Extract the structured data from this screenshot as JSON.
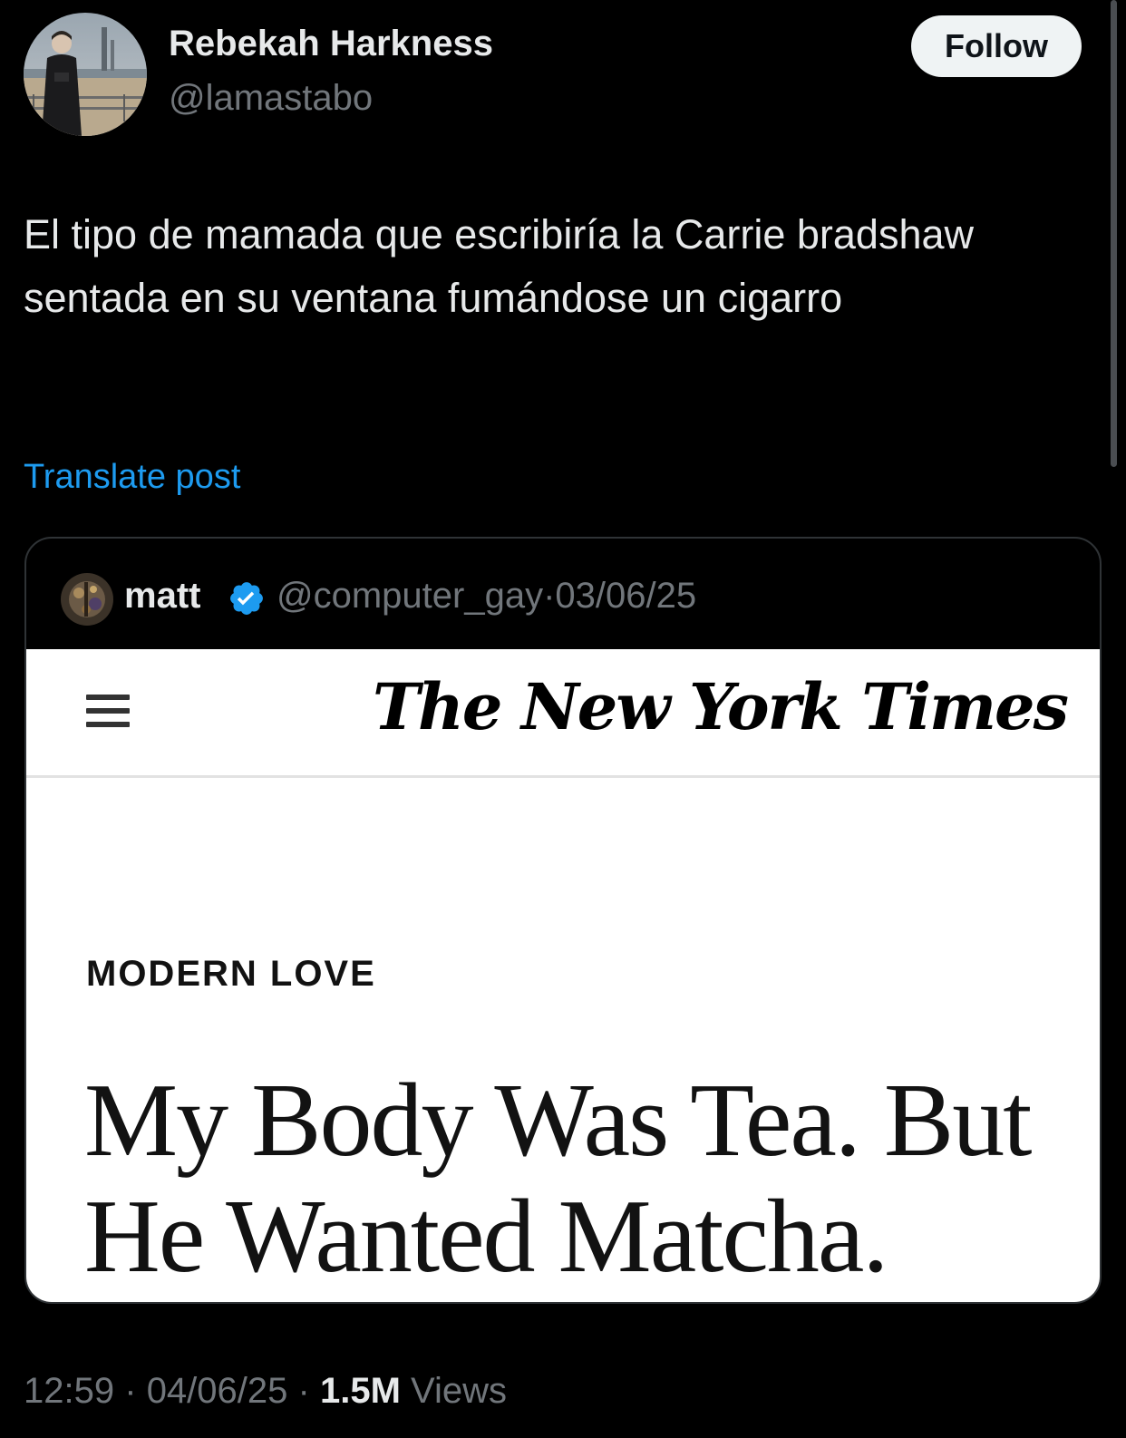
{
  "author": {
    "display_name": "Rebekah Harkness",
    "handle": "@lamastabo",
    "follow_label": "Follow"
  },
  "post": {
    "text": "El tipo de mamada que escribiría la Carrie bradshaw sentada en su ventana fumándose un cigarro",
    "translate_label": "Translate post"
  },
  "quoted_post": {
    "display_name": "matt",
    "handle": "@computer_gay",
    "separator": "·",
    "date": "03/06/25",
    "image": {
      "publication": "The New York Times",
      "kicker": "MODERN LOVE",
      "headline_line1": "My Body Was Tea. But",
      "headline_line2": "He Wanted Matcha."
    }
  },
  "meta": {
    "time": "12:59",
    "separator": "·",
    "date": "04/06/25",
    "views_count": "1.5M",
    "views_label": "Views"
  },
  "colors": {
    "background": "#000000",
    "primary_text": "#e7e9ea",
    "secondary_text": "#71767b",
    "link": "#1d9bf0",
    "verified": "#1d9bf0"
  },
  "icons": {
    "verified": "verified-badge-icon",
    "menu": "hamburger-menu-icon"
  }
}
